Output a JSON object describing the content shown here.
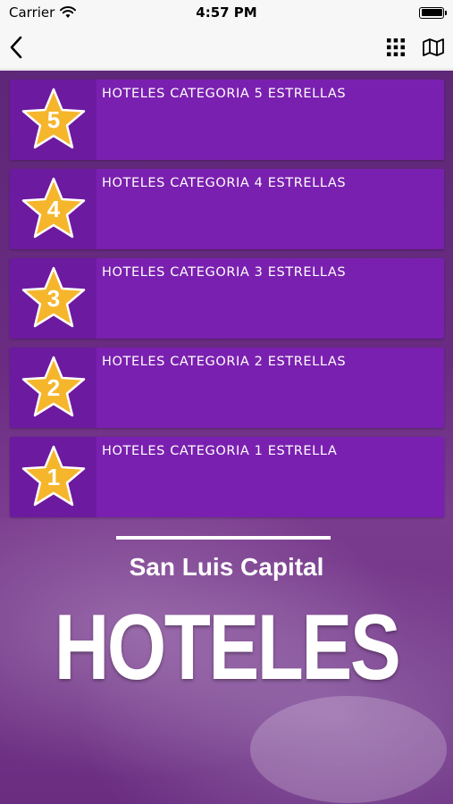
{
  "status_bar": {
    "carrier": "Carrier",
    "time": "4:57 PM"
  },
  "nav": {
    "back_icon": "chevron-left-icon",
    "grid_icon": "grid-icon",
    "map_icon": "map-icon"
  },
  "categories": [
    {
      "number": "5",
      "label": "HOTELES CATEGORIA 5 ESTRELLAS"
    },
    {
      "number": "4",
      "label": "HOTELES CATEGORIA 4 ESTRELLAS"
    },
    {
      "number": "3",
      "label": "HOTELES CATEGORIA 3 ESTRELLAS"
    },
    {
      "number": "2",
      "label": "HOTELES CATEGORIA 2 ESTRELLAS"
    },
    {
      "number": "1",
      "label": "HOTELES CATEGORIA 1 ESTRELLA"
    }
  ],
  "banner": {
    "subtitle": "San Luis Capital",
    "title": "HOTELES"
  },
  "colors": {
    "row": "#7a20b0",
    "star": "#f5b62c",
    "background": "#6a2c82"
  }
}
